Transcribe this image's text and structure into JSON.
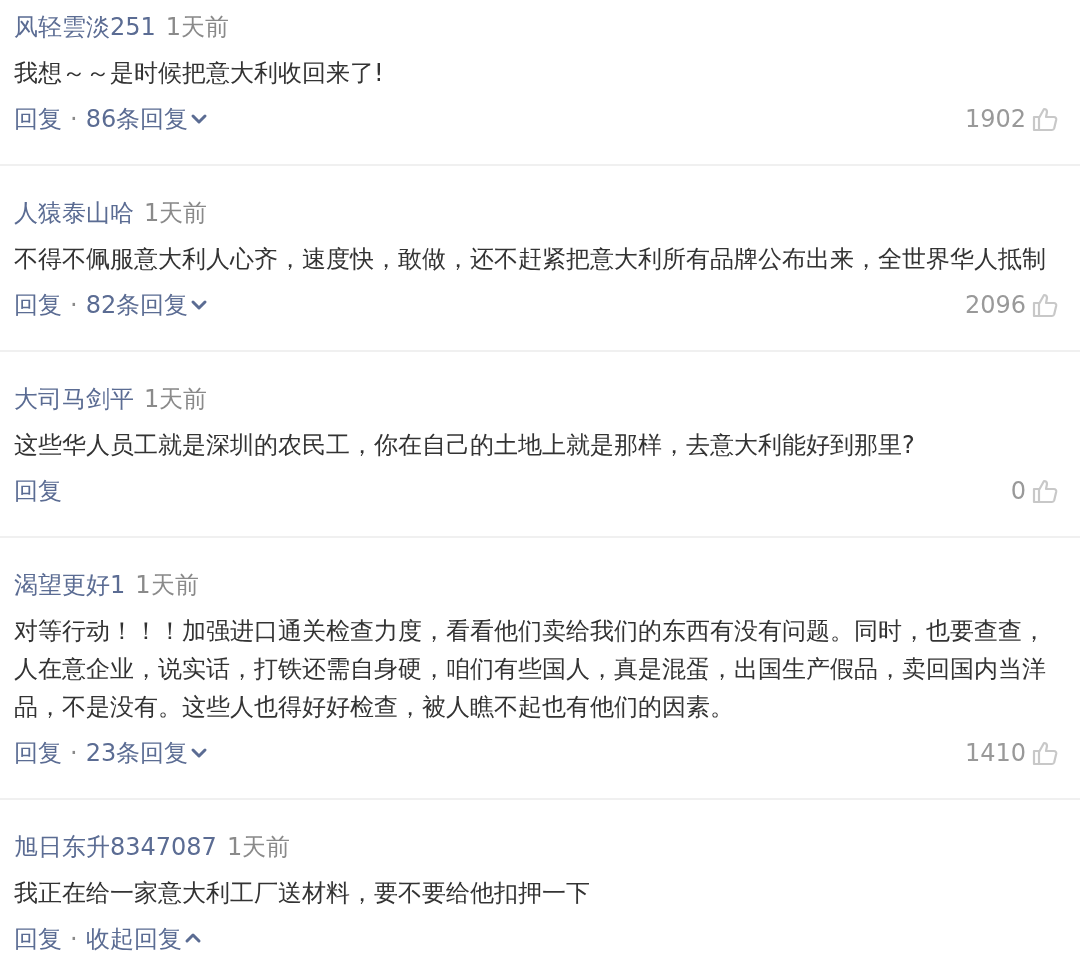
{
  "comments": [
    {
      "user": "风轻雲淡251",
      "time": "1天前",
      "text": "我想～～是时候把意大利收回来了!",
      "reply": "回复",
      "separator": "·",
      "thread": "86条回复",
      "expanded": false,
      "likes": "1902"
    },
    {
      "user": "人猿泰山哈",
      "time": "1天前",
      "text": "不得不佩服意大利人心齐，速度快，敢做，还不赶紧把意大利所有品牌公布出来，全世界华人抵制",
      "reply": "回复",
      "separator": "·",
      "thread": "82条回复",
      "expanded": false,
      "likes": "2096"
    },
    {
      "user": "大司马剑平",
      "time": "1天前",
      "text": "这些华人员工就是深圳的农民工，你在自己的土地上就是那样，去意大利能好到那里?",
      "reply": "回复",
      "likes": "0"
    },
    {
      "user": "渴望更好1",
      "time": "1天前",
      "text": [
        "对等行动！！！加强进口通关检查力度，看看他们卖给我们的东西有没有问题。同时，也要查查，",
        "人在意企业，说实话，打铁还需自身硬，咱们有些国人，真是混蛋，出国生产假品，卖回国内当洋",
        "品，不是没有。这些人也得好好检查，被人瞧不起也有他们的因素。"
      ],
      "reply": "回复",
      "separator": "·",
      "thread": "23条回复",
      "expanded": false,
      "likes": "1410"
    },
    {
      "user": "旭日东升8347087",
      "time": "1天前",
      "text": "我正在给一家意大利工厂送材料，要不要给他扣押一下",
      "reply": "回复",
      "separator": "·",
      "thread": "收起回复",
      "expanded": true
    }
  ]
}
